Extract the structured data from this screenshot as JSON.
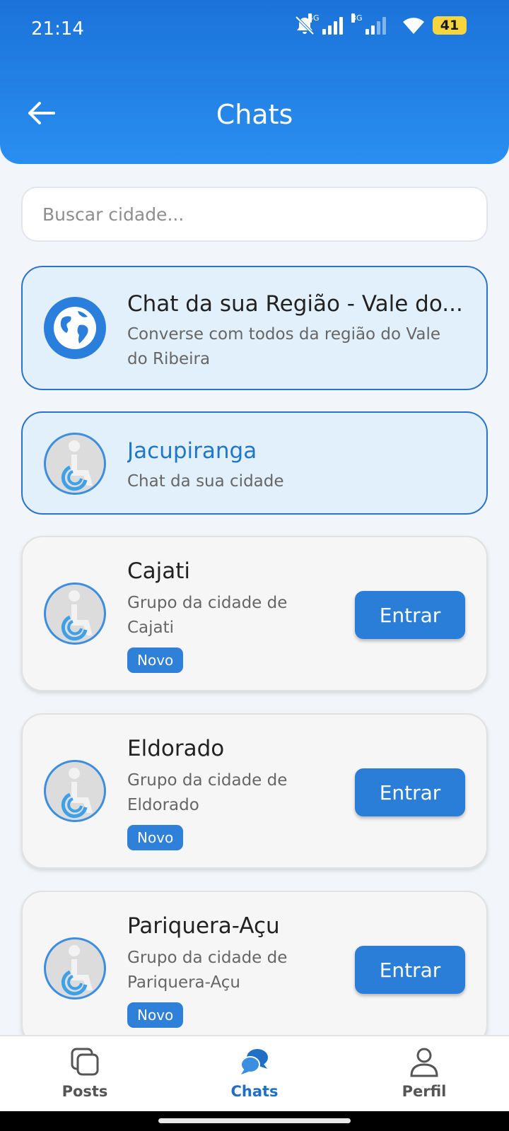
{
  "status_bar": {
    "time": "21:14",
    "network_1": "4G",
    "network_2": "3G",
    "battery": "41"
  },
  "header": {
    "title": "Chats"
  },
  "search": {
    "placeholder": "Buscar cidade..."
  },
  "region_chat": {
    "title": "Chat da sua Região - Vale do...",
    "subtitle_line1": "Converse com todos da região do Vale",
    "subtitle_line2": "do Ribeira"
  },
  "my_city_chat": {
    "title": "Jacupiranga",
    "subtitle": "Chat da sua cidade"
  },
  "city_groups": [
    {
      "name": "Cajati",
      "line1": "Grupo da cidade de",
      "line2": "Cajati",
      "badge": "Novo",
      "button": "Entrar"
    },
    {
      "name": "Eldorado",
      "line1": "Grupo da cidade de",
      "line2": "Eldorado",
      "badge": "Novo",
      "button": "Entrar"
    },
    {
      "name": "Pariquera-Açu",
      "line1": "Grupo da cidade de",
      "line2": "Pariquera-Açu",
      "badge": "Novo",
      "button": "Entrar"
    }
  ],
  "bottom_nav": [
    {
      "label": "Posts",
      "icon": "posts-icon",
      "active": false
    },
    {
      "label": "Chats",
      "icon": "chat-bubbles-icon",
      "active": true
    },
    {
      "label": "Perfil",
      "icon": "person-icon",
      "active": false
    }
  ],
  "colors": {
    "primary": "#2a7ed8",
    "header_gradient_top": "#1b73d9",
    "header_gradient_bottom": "#2a8ef0",
    "highlight_card_bg": "#e2f0fc",
    "active_nav": "#1f6fc4",
    "battery": "#f6d63e"
  }
}
